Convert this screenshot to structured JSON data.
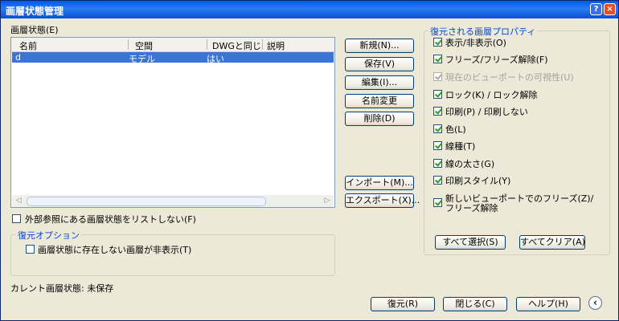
{
  "window": {
    "title": "画層状態管理",
    "help_glyph": "?",
    "close_glyph": "×"
  },
  "list": {
    "label": "画層状態(E)",
    "columns": [
      "名前",
      "空間",
      "DWGと同じ",
      "説明"
    ],
    "rows": [
      {
        "name": "d",
        "space": "モデル",
        "same_as_dwg": "はい",
        "description": ""
      }
    ]
  },
  "buttons": {
    "new": "新規(N)...",
    "save": "保存(V)",
    "edit": "編集(I)...",
    "rename": "名前変更",
    "delete": "削除(D)",
    "import": "インポート(M)...",
    "export": "エクスポート(X)...",
    "select_all": "すべて選択(S)",
    "clear_all": "すべてクリア(A)",
    "restore": "復元(R)",
    "close": "閉じる(C)",
    "help": "ヘルプ(H)",
    "back_glyph": "‹"
  },
  "xref_option": {
    "label": "外部参照にある画層状態をリストしない(F)",
    "checked": false
  },
  "restore_options": {
    "title": "復元オプション",
    "hide_missing": {
      "label": "画層状態に存在しない画層が非表示(T)",
      "checked": false
    }
  },
  "current_state": "カレント画層状態: 未保存",
  "properties": {
    "title": "復元される画層プロパティ",
    "items": [
      {
        "label": "表示/非表示(O)",
        "checked": true,
        "enabled": true
      },
      {
        "label": "フリーズ/フリーズ解除(F)",
        "checked": true,
        "enabled": true
      },
      {
        "label": "現在のビューポートの可視性(U)",
        "checked": true,
        "enabled": false
      },
      {
        "label": "ロック(K) / ロック解除",
        "checked": true,
        "enabled": true
      },
      {
        "label": "印刷(P) / 印刷しない",
        "checked": true,
        "enabled": true
      },
      {
        "label": "色(L)",
        "checked": true,
        "enabled": true
      },
      {
        "label": "線種(T)",
        "checked": true,
        "enabled": true
      },
      {
        "label": "線の太さ(G)",
        "checked": true,
        "enabled": true
      },
      {
        "label": "印刷スタイル(Y)",
        "checked": true,
        "enabled": true
      },
      {
        "label": "新しいビューポートでのフリーズ(Z)/",
        "label2": "フリーズ解除",
        "checked": true,
        "enabled": true
      }
    ]
  }
}
